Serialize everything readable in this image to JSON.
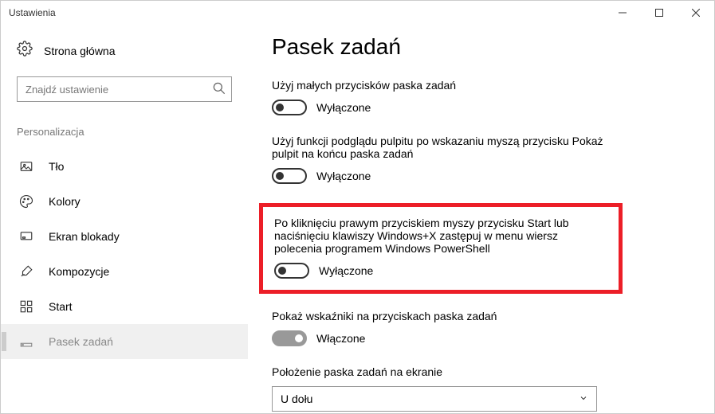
{
  "window": {
    "title": "Ustawienia"
  },
  "home": {
    "label": "Strona główna"
  },
  "search": {
    "placeholder": "Znajdź ustawienie"
  },
  "category": {
    "label": "Personalizacja"
  },
  "nav": {
    "items": [
      {
        "label": "Tło"
      },
      {
        "label": "Kolory"
      },
      {
        "label": "Ekran blokady"
      },
      {
        "label": "Kompozycje"
      },
      {
        "label": "Start"
      },
      {
        "label": "Pasek zadań"
      }
    ]
  },
  "page": {
    "title": "Pasek zadań"
  },
  "settings": {
    "smallButtons": {
      "text": "Użyj małych przycisków paska zadań",
      "state": "Wyłączone",
      "on": false
    },
    "peek": {
      "text": "Użyj funkcji podglądu pulpitu po wskazaniu myszą przycisku Pokaż pulpit na końcu paska zadań",
      "state": "Wyłączone",
      "on": false
    },
    "powershell": {
      "text": "Po kliknięciu prawym przyciskiem myszy przycisku Start lub naciśnięciu klawiszy Windows+X zastępuj w menu wiersz polecenia programem Windows PowerShell",
      "state": "Wyłączone",
      "on": false
    },
    "badges": {
      "text": "Pokaż wskaźniki na przyciskach paska zadań",
      "state": "Włączone",
      "on": true
    },
    "position": {
      "text": "Położenie paska zadań na ekranie",
      "value": "U dołu"
    }
  }
}
